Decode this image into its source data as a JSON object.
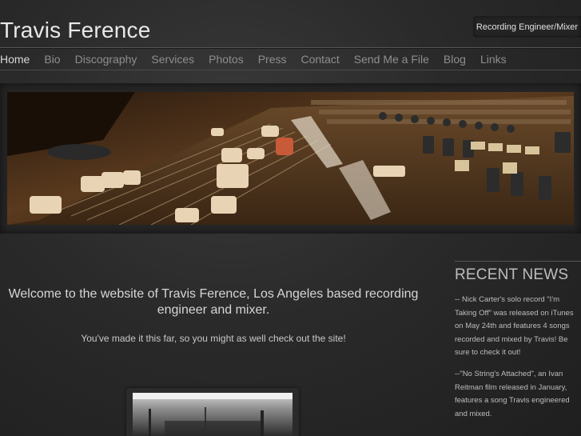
{
  "site": {
    "title": "Travis Ference",
    "tagline": "Recording Engineer/Mixer"
  },
  "nav": {
    "items": [
      {
        "label": "Home",
        "active": true
      },
      {
        "label": "Bio"
      },
      {
        "label": "Discography"
      },
      {
        "label": "Services"
      },
      {
        "label": "Photos"
      },
      {
        "label": "Press"
      },
      {
        "label": "Contact"
      },
      {
        "label": "Send Me a File"
      },
      {
        "label": "Blog"
      },
      {
        "label": "Links"
      }
    ]
  },
  "main": {
    "welcome": "Welcome to the website of Travis Ference, Los Angeles based recording engineer and mixer.",
    "subtext": "You've made it this far, so you might as well check out the site!"
  },
  "sidebar": {
    "heading": "RECENT NEWS",
    "news": [
      "-- Nick Carter's solo record \"I'm Taking Off\" was released on iTunes on May 24th and features 4 songs recorded and mixed by Travis! Be sure to check it out!",
      "--\"No String's Attached\", an Ivan Reitman film released in January, features a song Travis engineered and mixed."
    ]
  },
  "colors": {
    "background": "#2a2a2a",
    "nav_inactive": "#8e8e8e",
    "nav_active": "#d8d8d8",
    "banner_warm": "#c8a070"
  }
}
